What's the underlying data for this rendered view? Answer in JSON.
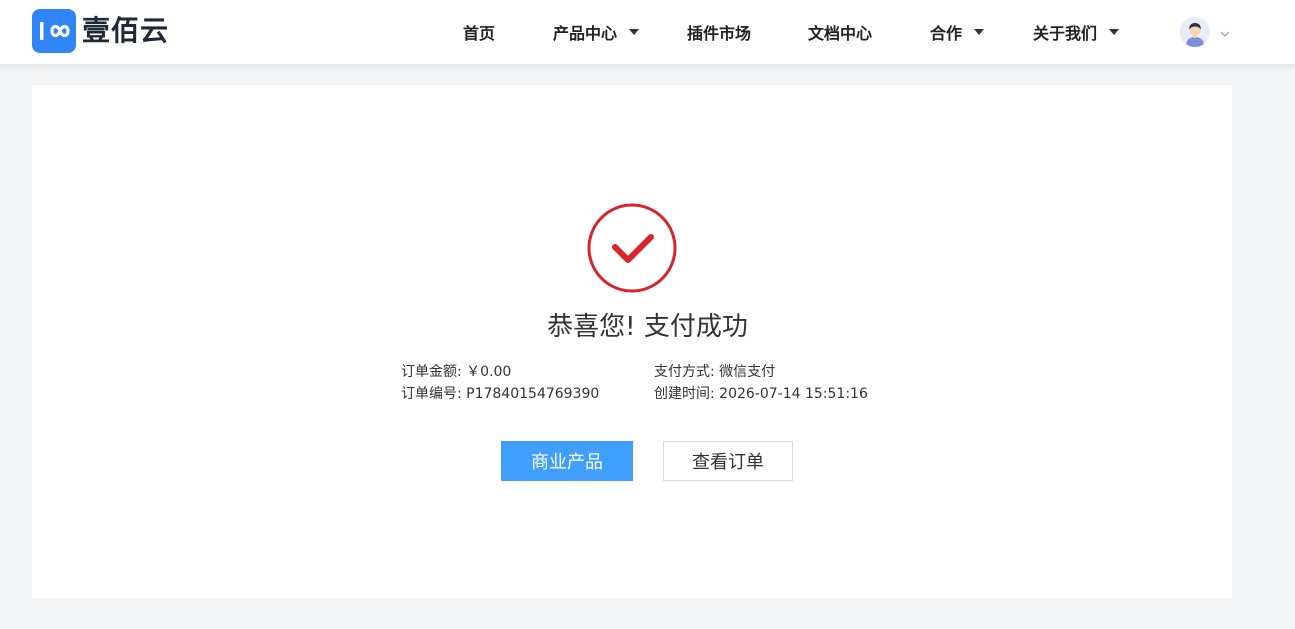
{
  "brand": {
    "name": "壹佰云",
    "accent_color": "#2f84f7"
  },
  "nav": {
    "items": [
      {
        "label": "首页",
        "has_dropdown": false
      },
      {
        "label": "产品中心",
        "has_dropdown": true
      },
      {
        "label": "插件市场",
        "has_dropdown": false
      },
      {
        "label": "文档中心",
        "has_dropdown": false
      },
      {
        "label": "合作",
        "has_dropdown": true
      },
      {
        "label": "关于我们",
        "has_dropdown": true
      }
    ]
  },
  "user_menu": {
    "icon": "user-avatar-icon",
    "chevron_icon": "chevron-down-icon"
  },
  "result": {
    "icon": "check-circle-icon",
    "icon_color": "#d9242a",
    "title": "恭喜您! 支付成功",
    "order_amount_label": "订单金额:",
    "order_amount_value": "￥0.00",
    "order_no_label": "订单编号:",
    "order_no_value": "P17840154769390",
    "pay_method_label": "支付方式:",
    "pay_method_value": "微信支付",
    "created_time_label": "创建时间:",
    "created_time_value": "2026-07-14 15:51:16"
  },
  "actions": {
    "primary_label": "商业产品",
    "secondary_label": "查看订单",
    "primary_color": "#409eff"
  }
}
